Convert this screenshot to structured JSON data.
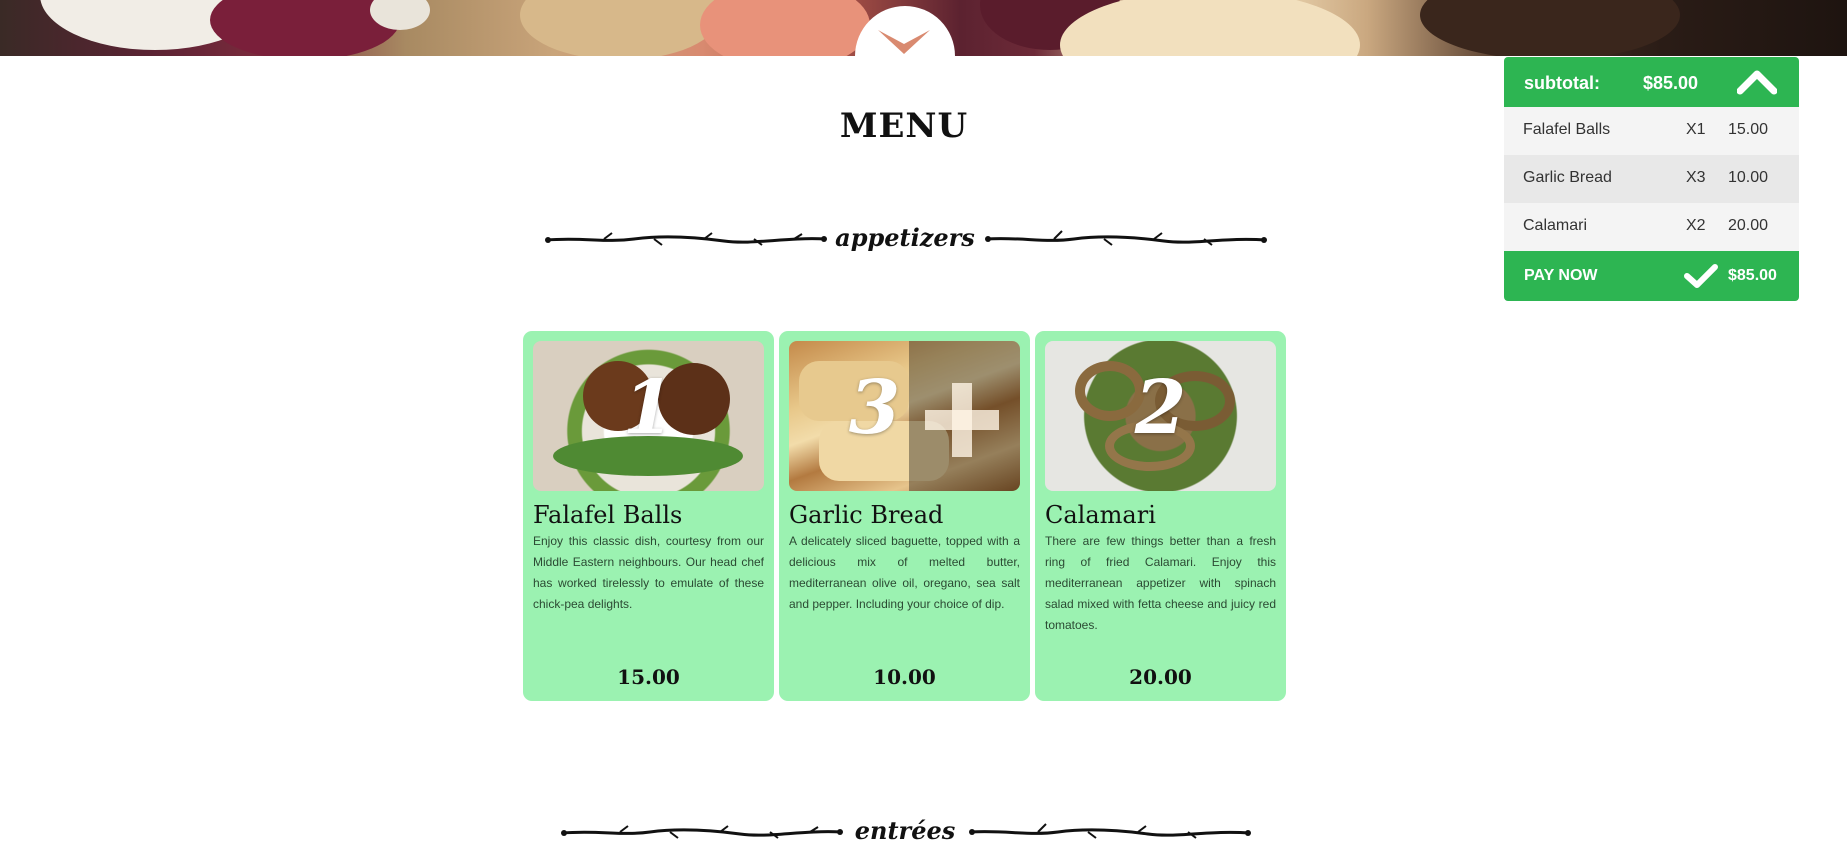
{
  "menu": {
    "title": "MENU"
  },
  "sections": [
    {
      "label": "appetizers"
    },
    {
      "label": "entrées"
    }
  ],
  "items": [
    {
      "quantity": "1",
      "name": "Falafel Balls",
      "description": "Enjoy this classic dish, courtesy from our Middle Eastern neighbours. Our head chef has worked tirelessly to emulate of these chick-pea delights.",
      "price": "15.00"
    },
    {
      "quantity": "3",
      "name": "Garlic Bread",
      "description": "A delicately sliced baguette, topped with a delicious mix of melted butter, mediterranean olive oil, oregano, sea salt and pepper. Including your choice of dip.",
      "price": "10.00"
    },
    {
      "quantity": "2",
      "name": "Calamari",
      "description": "There are few things better than a fresh ring of fried Calamari. Enjoy this mediterranean appetizer with spinach salad mixed with fetta cheese and juicy red tomatoes.",
      "price": "20.00"
    }
  ],
  "cart": {
    "subtotal_label": "subtotal:",
    "subtotal_amount": "$85.00",
    "rows": [
      {
        "name": "Falafel Balls",
        "qty": "X1",
        "price": "15.00"
      },
      {
        "name": "Garlic Bread",
        "qty": "X3",
        "price": "10.00"
      },
      {
        "name": "Calamari",
        "qty": "X2",
        "price": "20.00"
      }
    ],
    "pay_label": "PAY NOW",
    "pay_amount": "$85.00"
  },
  "icons": {
    "scroll": "chevron-down-icon",
    "collapse": "chevron-up-icon",
    "pay": "check-icon",
    "add": "plus-icon"
  },
  "colors": {
    "accent": "#2db552",
    "card": "#9bf2b1"
  }
}
